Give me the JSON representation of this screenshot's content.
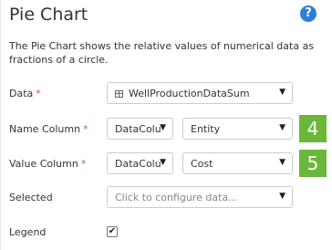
{
  "panel": {
    "title": "Pie Chart",
    "help_icon": "?",
    "description": "The Pie Chart shows the relative values of numerical data as fractions of a circle."
  },
  "fields": {
    "data": {
      "label": "Data",
      "required_mark": "*",
      "value": "WellProductionDataSum",
      "icon": "table-icon"
    },
    "name_column": {
      "label": "Name Column",
      "required_mark": "*",
      "type_value": "DataColu",
      "column_value": "Entity",
      "badge": "4"
    },
    "value_column": {
      "label": "Value Column",
      "required_mark": "*",
      "type_value": "DataColu",
      "column_value": "Cost",
      "badge": "5"
    },
    "selected": {
      "label": "Selected",
      "placeholder": "Click to configure data..."
    },
    "legend": {
      "label": "Legend",
      "checked": true,
      "check_glyph": "✔"
    }
  },
  "caret_glyph": "▼",
  "colors": {
    "badge": "#6ab83a",
    "help_icon": "#2f7fd8",
    "required": "#d9534f"
  }
}
